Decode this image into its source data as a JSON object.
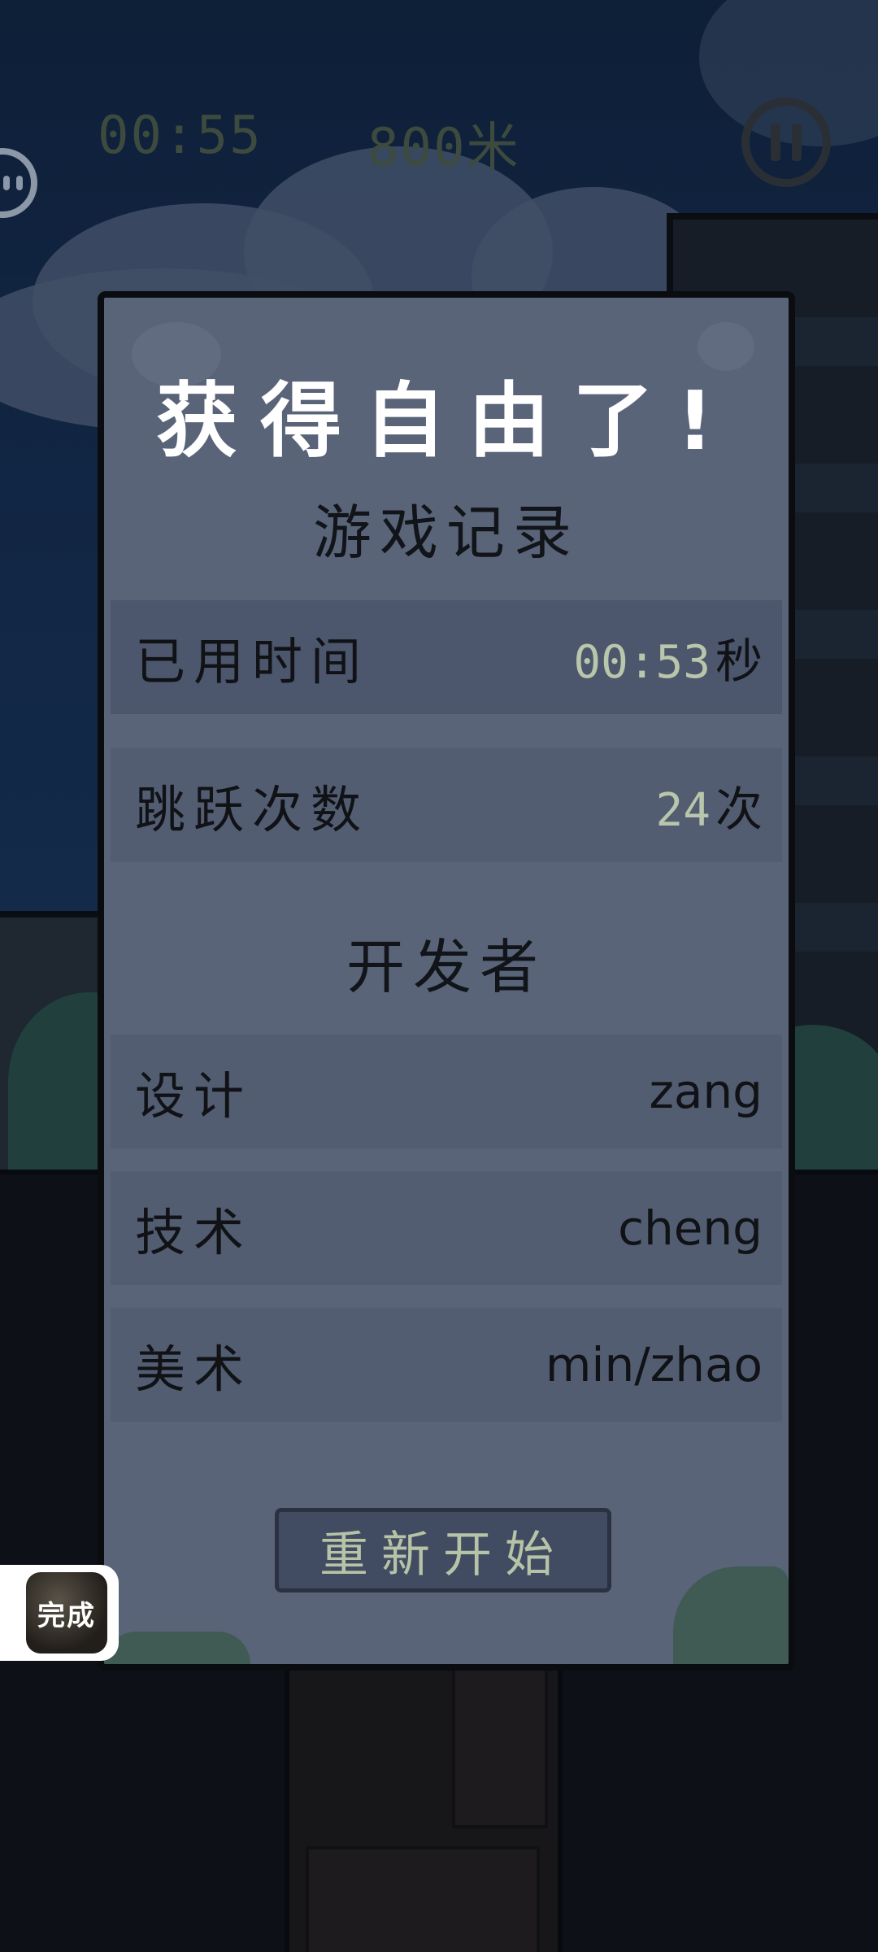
{
  "hud": {
    "time": "00:55",
    "distance": "800米",
    "pause_icon": "pause-icon",
    "face_icon": "character-face-icon"
  },
  "modal": {
    "title": "获得自由了!",
    "record_section": "游戏记录",
    "stats": [
      {
        "label": "已用时间",
        "number": "00:53",
        "unit": "秒"
      },
      {
        "label": "跳跃次数",
        "number": "24",
        "unit": "次"
      }
    ],
    "credits_section": "开发者",
    "credits": [
      {
        "role": "设计",
        "name": "zang"
      },
      {
        "role": "技术",
        "name": "cheng"
      },
      {
        "role": "美术",
        "name": "min/zhao"
      }
    ],
    "restart_label": "重新开始"
  },
  "app_badge": {
    "text": "完成"
  },
  "colors": {
    "modal_bg": "#5a6479",
    "row_dark": "#4c566c",
    "number_accent": "#b8c6ab",
    "button_bg": "#414b61",
    "button_text": "#b6c3a6"
  }
}
